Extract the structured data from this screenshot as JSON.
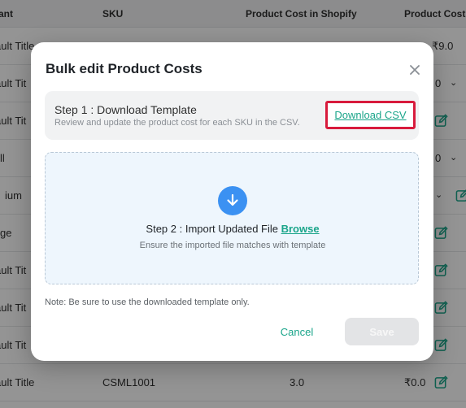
{
  "table": {
    "headers": [
      "ant",
      "SKU",
      "Product Cost in Shopify",
      "Product Cost i"
    ],
    "rows": [
      {
        "c1": "ault Title",
        "c2": "",
        "c3": "",
        "c4": "₹9.0"
      },
      {
        "c1": "ault Tit",
        "c2": "",
        "c3": "",
        "c4": "0"
      },
      {
        "c1": "ault Tit",
        "c2": "",
        "c3": "",
        "c4": ""
      },
      {
        "c1": "ll",
        "c2": "",
        "c3": "",
        "c4": "0"
      },
      {
        "c1": "ium",
        "c2": "",
        "c3": "",
        "c4": ""
      },
      {
        "c1": "ge",
        "c2": "",
        "c3": "",
        "c4": ""
      },
      {
        "c1": "ault Tit",
        "c2": "",
        "c3": "",
        "c4": ""
      },
      {
        "c1": "ault Tit",
        "c2": "",
        "c3": "",
        "c4": ""
      },
      {
        "c1": "ault Tit",
        "c2": "",
        "c3": "",
        "c4": ""
      },
      {
        "c1": "ault Title",
        "c2": "CSML1001",
        "c3": "3.0",
        "c4": "₹0.0"
      }
    ]
  },
  "modal": {
    "title": "Bulk edit Product Costs",
    "close_icon": "close-icon",
    "step1": {
      "title": "Step 1 : Download Template",
      "subtitle": "Review and update the product cost for each SKU in the CSV.",
      "download_label": "Download CSV"
    },
    "step2": {
      "icon": "download-arrow-icon",
      "title_prefix": "Step 2 : Import Updated File ",
      "browse_label": "Browse",
      "subtitle": "Ensure the imported file matches with template"
    },
    "note": "Note: Be sure to use the downloaded template only.",
    "cancel_label": "Cancel",
    "save_label": "Save"
  },
  "colors": {
    "accent": "#1aa58a",
    "highlight_border": "#d81b3c",
    "upload_icon_bg": "#3b91f2",
    "dropzone_bg": "#eef6fd"
  }
}
